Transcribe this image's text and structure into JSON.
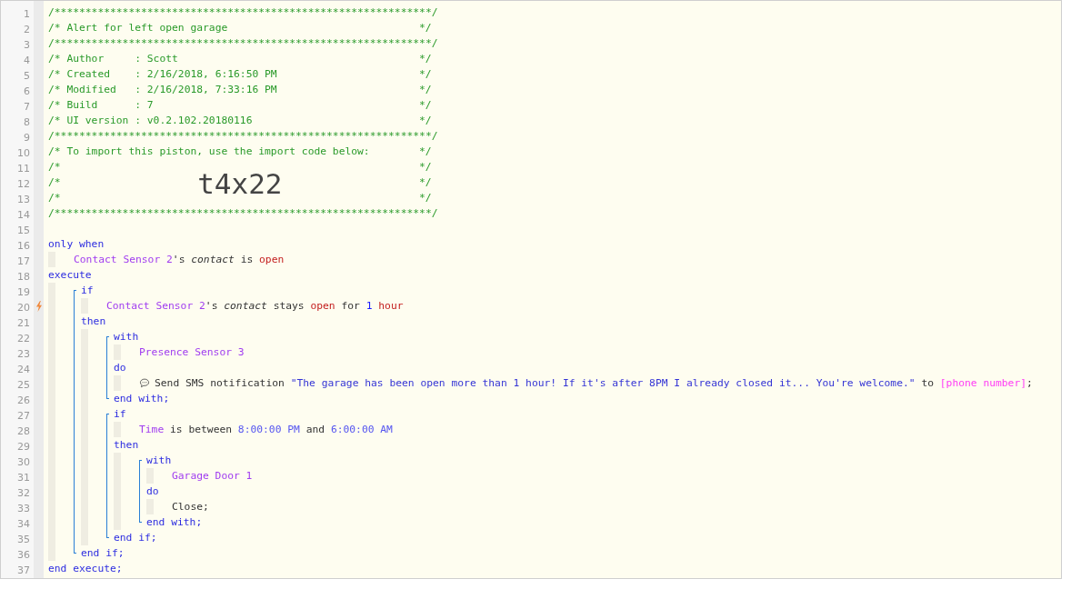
{
  "code": [
    {
      "kind": "line",
      "number": "1",
      "trigger": false,
      "tokens": [
        {
          "kind": "comment",
          "text": "/*************************************************************/"
        }
      ]
    },
    {
      "kind": "line",
      "number": "2",
      "trigger": false,
      "tokens": [
        {
          "kind": "comment",
          "text": "/* Alert for left open garage"
        },
        {
          "kind": "comment-end",
          "text": "*/"
        }
      ]
    },
    {
      "kind": "line",
      "number": "3",
      "trigger": false,
      "tokens": [
        {
          "kind": "comment",
          "text": "/*************************************************************/"
        }
      ]
    },
    {
      "kind": "line",
      "number": "4",
      "trigger": false,
      "tokens": [
        {
          "kind": "comment",
          "text": "/* Author     : Scott"
        },
        {
          "kind": "comment-end",
          "text": "*/"
        }
      ]
    },
    {
      "kind": "line",
      "number": "5",
      "trigger": false,
      "tokens": [
        {
          "kind": "comment",
          "text": "/* Created    : 2/16/2018, 6:16:50 PM"
        },
        {
          "kind": "comment-end",
          "text": "*/"
        }
      ]
    },
    {
      "kind": "line",
      "number": "6",
      "trigger": false,
      "tokens": [
        {
          "kind": "comment",
          "text": "/* Modified   : 2/16/2018, 7:33:16 PM"
        },
        {
          "kind": "comment-end",
          "text": "*/"
        }
      ]
    },
    {
      "kind": "line",
      "number": "7",
      "trigger": false,
      "tokens": [
        {
          "kind": "comment",
          "text": "/* Build      : 7"
        },
        {
          "kind": "comment-end",
          "text": "*/"
        }
      ]
    },
    {
      "kind": "line",
      "number": "8",
      "trigger": false,
      "tokens": [
        {
          "kind": "comment",
          "text": "/* UI version : v0.2.102.20180116"
        },
        {
          "kind": "comment-end",
          "text": "*/"
        }
      ]
    },
    {
      "kind": "line",
      "number": "9",
      "trigger": false,
      "tokens": [
        {
          "kind": "comment",
          "text": "/*************************************************************/"
        }
      ]
    },
    {
      "kind": "line",
      "number": "10",
      "trigger": false,
      "tokens": [
        {
          "kind": "comment",
          "text": "/* To import this piston, use the import code below:"
        },
        {
          "kind": "comment-end",
          "text": "*/"
        }
      ]
    },
    {
      "kind": "line",
      "number": "11",
      "trigger": false,
      "tokens": [
        {
          "kind": "comment",
          "text": "/*"
        },
        {
          "kind": "comment-end",
          "text": "*/"
        }
      ]
    },
    {
      "kind": "line",
      "number": "12",
      "trigger": false,
      "tokens": [
        {
          "kind": "comment",
          "text": "/*"
        },
        {
          "kind": "code",
          "text": "t4x22"
        },
        {
          "kind": "comment-end",
          "text": "*/"
        }
      ]
    },
    {
      "kind": "line",
      "number": "13",
      "trigger": false,
      "tokens": [
        {
          "kind": "comment",
          "text": "/*"
        },
        {
          "kind": "comment-end",
          "text": "*/"
        }
      ]
    },
    {
      "kind": "line",
      "number": "14",
      "trigger": false,
      "tokens": [
        {
          "kind": "comment",
          "text": "/*************************************************************/"
        }
      ]
    },
    {
      "kind": "line",
      "number": "15",
      "trigger": false
    },
    {
      "kind": "line",
      "number": "16",
      "trigger": false,
      "tokens": [
        {
          "kind": "keyword",
          "text": "only when"
        }
      ]
    },
    {
      "kind": "indent",
      "children": [
        {
          "kind": "line",
          "number": "17",
          "trigger": false,
          "tokens": [
            {
              "kind": "device",
              "text": "Contact Sensor 2"
            },
            {
              "kind": "text",
              "text": "'s "
            },
            {
              "kind": "attr",
              "text": "contact"
            },
            {
              "kind": "text",
              "text": " is "
            },
            {
              "kind": "red",
              "text": "open"
            }
          ]
        }
      ]
    },
    {
      "kind": "line",
      "number": "18",
      "trigger": false,
      "tokens": [
        {
          "kind": "keyword",
          "text": "execute"
        }
      ]
    },
    {
      "kind": "indent",
      "children": [
        {
          "kind": "block",
          "children": [
            {
              "kind": "line",
              "number": "19",
              "trigger": false,
              "tokens": [
                {
                  "kind": "keyword",
                  "text": "if"
                }
              ]
            },
            {
              "kind": "indent",
              "children": [
                {
                  "kind": "line",
                  "number": "20",
                  "trigger": true,
                  "tokens": [
                    {
                      "kind": "device",
                      "text": "Contact Sensor 2"
                    },
                    {
                      "kind": "text",
                      "text": "'s "
                    },
                    {
                      "kind": "attr",
                      "text": "contact"
                    },
                    {
                      "kind": "text",
                      "text": " stays "
                    },
                    {
                      "kind": "red",
                      "text": "open"
                    },
                    {
                      "kind": "text",
                      "text": " for "
                    },
                    {
                      "kind": "value",
                      "text": "1"
                    },
                    {
                      "kind": "red",
                      "text": " hour"
                    }
                  ]
                }
              ]
            },
            {
              "kind": "line",
              "number": "21",
              "trigger": false,
              "tokens": [
                {
                  "kind": "keyword",
                  "text": "then"
                }
              ]
            },
            {
              "kind": "indent",
              "children": [
                {
                  "kind": "block",
                  "children": [
                    {
                      "kind": "line",
                      "number": "22",
                      "trigger": false,
                      "tokens": [
                        {
                          "kind": "keyword",
                          "text": "with"
                        }
                      ]
                    },
                    {
                      "kind": "indent",
                      "children": [
                        {
                          "kind": "line",
                          "number": "23",
                          "trigger": false,
                          "tokens": [
                            {
                              "kind": "device",
                              "text": "Presence Sensor 3"
                            }
                          ]
                        }
                      ]
                    },
                    {
                      "kind": "line",
                      "number": "24",
                      "trigger": false,
                      "tokens": [
                        {
                          "kind": "keyword",
                          "text": "do"
                        }
                      ]
                    },
                    {
                      "kind": "indent",
                      "children": [
                        {
                          "kind": "line",
                          "number": "25",
                          "trigger": false,
                          "tokens": [
                            {
                              "kind": "action",
                              "text": "Send SMS notification "
                            },
                            {
                              "kind": "string",
                              "text": "\"The garage has been open more than 1 hour! If it's after 8PM I already closed it... You're welcome.\""
                            },
                            {
                              "kind": "text",
                              "text": " to "
                            },
                            {
                              "kind": "variable",
                              "text": "[phone number]"
                            },
                            {
                              "kind": "text",
                              "text": ";"
                            }
                          ]
                        }
                      ]
                    },
                    {
                      "kind": "line",
                      "number": "26",
                      "trigger": false,
                      "tokens": [
                        {
                          "kind": "keyword",
                          "text": "end with;"
                        }
                      ]
                    }
                  ]
                },
                {
                  "kind": "block",
                  "children": [
                    {
                      "kind": "line",
                      "number": "27",
                      "trigger": false,
                      "tokens": [
                        {
                          "kind": "keyword",
                          "text": "if"
                        }
                      ]
                    },
                    {
                      "kind": "indent",
                      "children": [
                        {
                          "kind": "line",
                          "number": "28",
                          "trigger": false,
                          "tokens": [
                            {
                              "kind": "device",
                              "text": "Time"
                            },
                            {
                              "kind": "text",
                              "text": " is between "
                            },
                            {
                              "kind": "time",
                              "text": "8:00:00 PM"
                            },
                            {
                              "kind": "text",
                              "text": " and "
                            },
                            {
                              "kind": "time",
                              "text": "6:00:00 AM"
                            }
                          ]
                        }
                      ]
                    },
                    {
                      "kind": "line",
                      "number": "29",
                      "trigger": false,
                      "tokens": [
                        {
                          "kind": "keyword",
                          "text": "then"
                        }
                      ]
                    },
                    {
                      "kind": "indent",
                      "children": [
                        {
                          "kind": "block",
                          "children": [
                            {
                              "kind": "line",
                              "number": "30",
                              "trigger": false,
                              "tokens": [
                                {
                                  "kind": "keyword",
                                  "text": "with"
                                }
                              ]
                            },
                            {
                              "kind": "indent",
                              "children": [
                                {
                                  "kind": "line",
                                  "number": "31",
                                  "trigger": false,
                                  "tokens": [
                                    {
                                      "kind": "device",
                                      "text": "Garage Door 1"
                                    }
                                  ]
                                }
                              ]
                            },
                            {
                              "kind": "line",
                              "number": "32",
                              "trigger": false,
                              "tokens": [
                                {
                                  "kind": "keyword",
                                  "text": "do"
                                }
                              ]
                            },
                            {
                              "kind": "indent",
                              "children": [
                                {
                                  "kind": "line",
                                  "number": "33",
                                  "trigger": false,
                                  "tokens": [
                                    {
                                      "kind": "text",
                                      "text": "Close;"
                                    }
                                  ]
                                }
                              ]
                            },
                            {
                              "kind": "line",
                              "number": "34",
                              "trigger": false,
                              "tokens": [
                                {
                                  "kind": "keyword",
                                  "text": "end with;"
                                }
                              ]
                            }
                          ]
                        }
                      ]
                    },
                    {
                      "kind": "line",
                      "number": "35",
                      "trigger": false,
                      "tokens": [
                        {
                          "kind": "keyword",
                          "text": "end if;"
                        }
                      ]
                    }
                  ]
                }
              ]
            },
            {
              "kind": "line",
              "number": "36",
              "trigger": false,
              "tokens": [
                {
                  "kind": "keyword",
                  "text": "end if;"
                }
              ]
            }
          ]
        }
      ]
    },
    {
      "kind": "line",
      "number": "37",
      "trigger": false,
      "tokens": [
        {
          "kind": "keyword",
          "text": "end execute;"
        }
      ]
    }
  ]
}
